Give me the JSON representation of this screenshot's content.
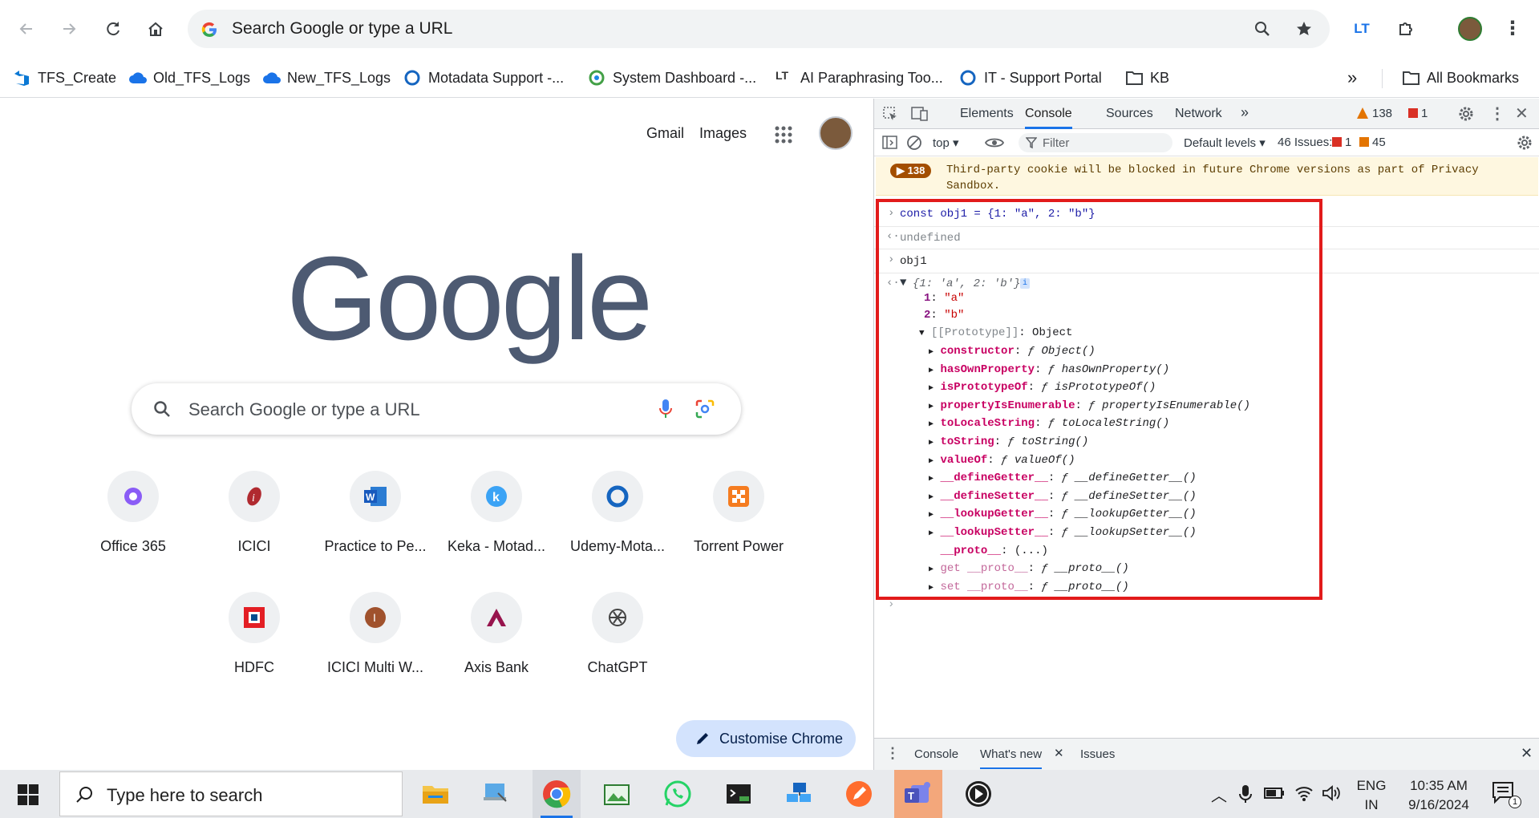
{
  "browser": {
    "omnibox_placeholder": "Search Google or type a URL",
    "bookmarks": [
      {
        "label": "TFS_Create",
        "icon": "azure-devops-icon"
      },
      {
        "label": "Old_TFS_Logs",
        "icon": "cloud-icon"
      },
      {
        "label": "New_TFS_Logs",
        "icon": "cloud-icon"
      },
      {
        "label": "Motadata Support -...",
        "icon": "motadata-icon"
      },
      {
        "label": "System Dashboard -...",
        "icon": "dashboard-icon"
      },
      {
        "label": "AI Paraphrasing Too...",
        "icon": "paraphrase-icon"
      },
      {
        "label": "IT - Support Portal",
        "icon": "motadata-icon"
      },
      {
        "label": "KB",
        "icon": "folder-icon"
      }
    ],
    "all_bookmarks": "All Bookmarks"
  },
  "ntp": {
    "gmail": "Gmail",
    "images": "Images",
    "logo": "Google",
    "search_placeholder": "Search Google or type a URL",
    "shortcuts": [
      {
        "label": "Office 365"
      },
      {
        "label": "ICICI"
      },
      {
        "label": "Practice to Pe..."
      },
      {
        "label": "Keka - Motad..."
      },
      {
        "label": "Udemy-Mota..."
      },
      {
        "label": "Torrent Power"
      },
      {
        "label": "HDFC"
      },
      {
        "label": "ICICI Multi W..."
      },
      {
        "label": "Axis Bank"
      },
      {
        "label": "ChatGPT"
      }
    ],
    "customise": "Customise Chrome"
  },
  "devtools": {
    "tabs": [
      "Elements",
      "Console",
      "Sources",
      "Network"
    ],
    "warnings_count": "138",
    "errors_count": "1",
    "context": "top",
    "filter_placeholder": "Filter",
    "levels": "Default levels",
    "issues_label": "46 Issues:",
    "issues_errors": "1",
    "issues_warnings": "45",
    "banner_count": "138",
    "banner_text": "Third-party cookie will be blocked in future Chrome versions as part of Privacy Sandbox.",
    "console": {
      "input1": "const obj1 = {1: \"a\", 2: \"b\"}",
      "result1": "undefined",
      "input2": "obj1",
      "object_preview": "{1: 'a', 2: 'b'}",
      "prop1_key": "1",
      "prop1_val": "\"a\"",
      "prop2_key": "2",
      "prop2_val": "\"b\"",
      "prototype_label": "[[Prototype]]",
      "prototype_val": "Object",
      "members": [
        {
          "key": "constructor",
          "val": "Object()"
        },
        {
          "key": "hasOwnProperty",
          "val": "hasOwnProperty()"
        },
        {
          "key": "isPrototypeOf",
          "val": "isPrototypeOf()"
        },
        {
          "key": "propertyIsEnumerable",
          "val": "propertyIsEnumerable()"
        },
        {
          "key": "toLocaleString",
          "val": "toLocaleString()"
        },
        {
          "key": "toString",
          "val": "toString()"
        },
        {
          "key": "valueOf",
          "val": "valueOf()"
        },
        {
          "key": "__defineGetter__",
          "val": "__defineGetter__()"
        },
        {
          "key": "__defineSetter__",
          "val": "__defineSetter__()"
        },
        {
          "key": "__lookupGetter__",
          "val": "__lookupGetter__()"
        },
        {
          "key": "__lookupSetter__",
          "val": "__lookupSetter__()"
        }
      ],
      "proto_key": "__proto__",
      "proto_val": "(...)",
      "get_proto": "get __proto__",
      "set_proto": "set __proto__",
      "proto_fn": "__proto__()"
    },
    "drawer_tabs": [
      "Console",
      "What's new",
      "Issues"
    ]
  },
  "taskbar": {
    "search_placeholder": "Type here to search",
    "lang1": "ENG",
    "lang2": "IN",
    "time": "10:35 AM",
    "date": "9/16/2024",
    "notification_count": "1"
  }
}
